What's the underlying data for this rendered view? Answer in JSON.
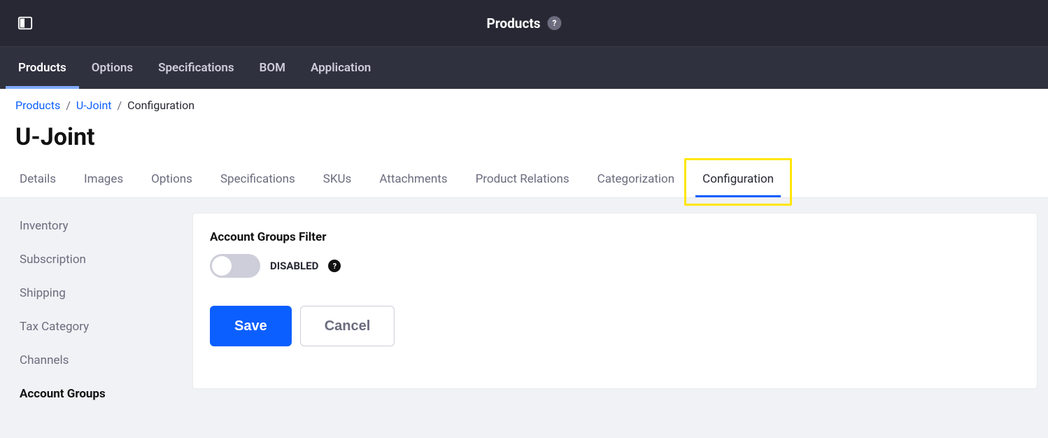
{
  "topbar": {
    "title": "Products",
    "help_label": "?"
  },
  "mainnav": {
    "items": [
      {
        "label": "Products",
        "active": true
      },
      {
        "label": "Options",
        "active": false
      },
      {
        "label": "Specifications",
        "active": false
      },
      {
        "label": "BOM",
        "active": false
      },
      {
        "label": "Application",
        "active": false
      }
    ]
  },
  "breadcrumbs": {
    "items": [
      {
        "label": "Products",
        "link": true
      },
      {
        "label": "U-Joint",
        "link": true
      },
      {
        "label": "Configuration",
        "link": false
      }
    ]
  },
  "page": {
    "title": "U-Joint"
  },
  "htabs": {
    "items": [
      {
        "label": "Details",
        "active": false
      },
      {
        "label": "Images",
        "active": false
      },
      {
        "label": "Options",
        "active": false
      },
      {
        "label": "Specifications",
        "active": false
      },
      {
        "label": "SKUs",
        "active": false
      },
      {
        "label": "Attachments",
        "active": false
      },
      {
        "label": "Product Relations",
        "active": false
      },
      {
        "label": "Categorization",
        "active": false
      },
      {
        "label": "Configuration",
        "active": true
      }
    ]
  },
  "sidenav": {
    "items": [
      {
        "label": "Inventory",
        "active": false
      },
      {
        "label": "Subscription",
        "active": false
      },
      {
        "label": "Shipping",
        "active": false
      },
      {
        "label": "Tax Category",
        "active": false
      },
      {
        "label": "Channels",
        "active": false
      },
      {
        "label": "Account Groups",
        "active": true
      }
    ]
  },
  "panel": {
    "field_label": "Account Groups Filter",
    "toggle_state": "DISABLED",
    "hint_label": "?",
    "save_label": "Save",
    "cancel_label": "Cancel"
  }
}
